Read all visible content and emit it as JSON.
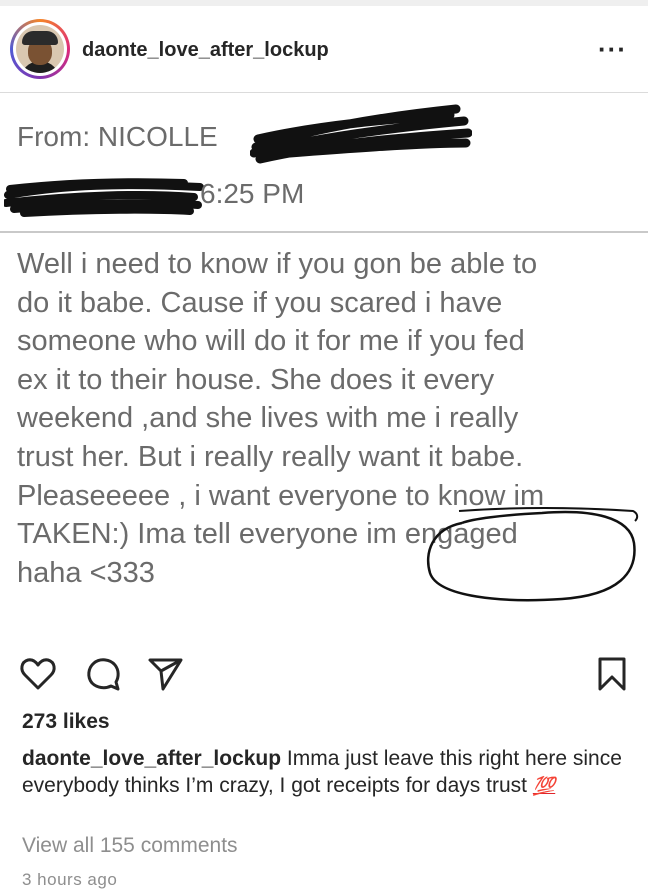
{
  "post": {
    "username": "daonte_love_after_lockup",
    "more_label": "···"
  },
  "screenshot": {
    "from_text": "From: NICOLLE",
    "time_text": "6:25 PM",
    "message_lines": [
      "Well i need to know if you gon be able to",
      "do it babe. Cause if you scared i have",
      "someone who will do it for me if you fed",
      "ex it to their house. She does it every",
      "weekend ,and she lives with me i really",
      "trust her. But i really really want it babe.",
      "Pleaseeeee , i want everyone to know im",
      "TAKEN:) Ima tell everyone im engaged",
      "haha <333"
    ]
  },
  "icons": {
    "like": "heart-icon",
    "comment": "comment-icon",
    "share": "share-icon",
    "save": "bookmark-icon"
  },
  "likes_text": "273 likes",
  "caption": {
    "username": "daonte_love_after_lockup",
    "text": " Imma just leave this right here since everybody thinks I’m crazy, I got receipts for days trust ",
    "emoji": "💯"
  },
  "comments_text": "View all 155 comments",
  "time_ago": "3 hours ago"
}
